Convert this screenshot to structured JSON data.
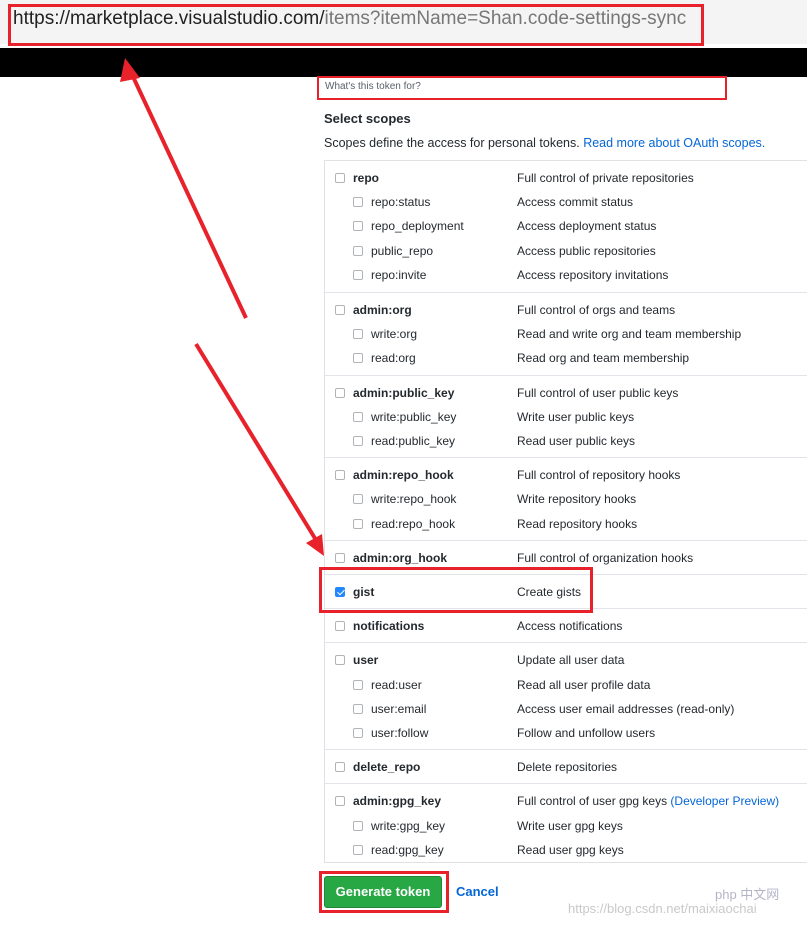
{
  "address_bar": {
    "host": "https://marketplace.visualstudio.com/",
    "path": "items?itemName=Shan.code-settings-sync"
  },
  "note": {
    "hint": "What's this token for?"
  },
  "scopes": {
    "title": "Select scopes",
    "description": "Scopes define the access for personal tokens.",
    "read_more": "Read more about OAuth scopes.",
    "groups": [
      {
        "label": "repo",
        "desc": "Full control of private repositories",
        "checked": false,
        "children": [
          {
            "label": "repo:status",
            "desc": "Access commit status"
          },
          {
            "label": "repo_deployment",
            "desc": "Access deployment status"
          },
          {
            "label": "public_repo",
            "desc": "Access public repositories"
          },
          {
            "label": "repo:invite",
            "desc": "Access repository invitations"
          }
        ]
      },
      {
        "label": "admin:org",
        "desc": "Full control of orgs and teams",
        "checked": false,
        "children": [
          {
            "label": "write:org",
            "desc": "Read and write org and team membership"
          },
          {
            "label": "read:org",
            "desc": "Read org and team membership"
          }
        ]
      },
      {
        "label": "admin:public_key",
        "desc": "Full control of user public keys",
        "checked": false,
        "children": [
          {
            "label": "write:public_key",
            "desc": "Write user public keys"
          },
          {
            "label": "read:public_key",
            "desc": "Read user public keys"
          }
        ]
      },
      {
        "label": "admin:repo_hook",
        "desc": "Full control of repository hooks",
        "checked": false,
        "children": [
          {
            "label": "write:repo_hook",
            "desc": "Write repository hooks"
          },
          {
            "label": "read:repo_hook",
            "desc": "Read repository hooks"
          }
        ]
      },
      {
        "label": "admin:org_hook",
        "desc": "Full control of organization hooks",
        "checked": false,
        "children": []
      },
      {
        "label": "gist",
        "desc": "Create gists",
        "checked": true,
        "children": []
      },
      {
        "label": "notifications",
        "desc": "Access notifications",
        "checked": false,
        "children": []
      },
      {
        "label": "user",
        "desc": "Update all user data",
        "checked": false,
        "children": [
          {
            "label": "read:user",
            "desc": "Read all user profile data"
          },
          {
            "label": "user:email",
            "desc": "Access user email addresses (read-only)"
          },
          {
            "label": "user:follow",
            "desc": "Follow and unfollow users"
          }
        ]
      },
      {
        "label": "delete_repo",
        "desc": "Delete repositories",
        "checked": false,
        "children": []
      },
      {
        "label": "admin:gpg_key",
        "desc": "Full control of user gpg keys",
        "desc_link": "(Developer Preview)",
        "checked": false,
        "children": [
          {
            "label": "write:gpg_key",
            "desc": "Write user gpg keys"
          },
          {
            "label": "read:gpg_key",
            "desc": "Read user gpg keys"
          }
        ]
      }
    ]
  },
  "actions": {
    "generate": "Generate token",
    "cancel": "Cancel"
  },
  "watermark": "https://blog.csdn.net/maixiaochai",
  "php_logo": "php 中文网",
  "colors": {
    "annotation_red": "#e8222b",
    "green_button": "#28a745",
    "link_blue": "#0366d6",
    "checkbox_blue": "#2188ff"
  }
}
